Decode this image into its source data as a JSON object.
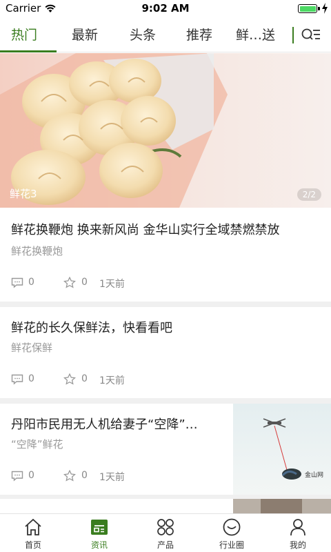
{
  "status_bar": {
    "carrier": "Carrier",
    "time": "9:02 AM"
  },
  "tabs": [
    {
      "label": "热门",
      "active": true
    },
    {
      "label": "最新",
      "active": false
    },
    {
      "label": "头条",
      "active": false
    },
    {
      "label": "推荐",
      "active": false
    },
    {
      "label": "鲜…送",
      "active": false
    }
  ],
  "banner": {
    "caption": "鲜花3",
    "page_indicator": "2/2"
  },
  "articles": [
    {
      "title": "鲜花换鞭炮 换来新风尚 金华山实行全域禁燃禁放",
      "tag": "鲜花换鞭炮",
      "comments": "0",
      "likes": "0",
      "time": "1天前"
    },
    {
      "title": "鲜花的长久保鲜法，快看看吧",
      "tag": "鲜花保鲜",
      "comments": "0",
      "likes": "0",
      "time": "1天前"
    },
    {
      "title": "丹阳市民用无人机给妻子“空降”…",
      "tag": "“空降”鲜花",
      "comments": "0",
      "likes": "0",
      "time": "1天前"
    }
  ],
  "bottom_nav": [
    {
      "label": "首页",
      "icon": "home-icon",
      "active": false
    },
    {
      "label": "资讯",
      "icon": "news-icon",
      "active": true
    },
    {
      "label": "产品",
      "icon": "grid-icon",
      "active": false
    },
    {
      "label": "行业圈",
      "icon": "smile-icon",
      "active": false
    },
    {
      "label": "我的",
      "icon": "user-icon",
      "active": false
    }
  ],
  "colors": {
    "accent": "#3a7d1f"
  }
}
